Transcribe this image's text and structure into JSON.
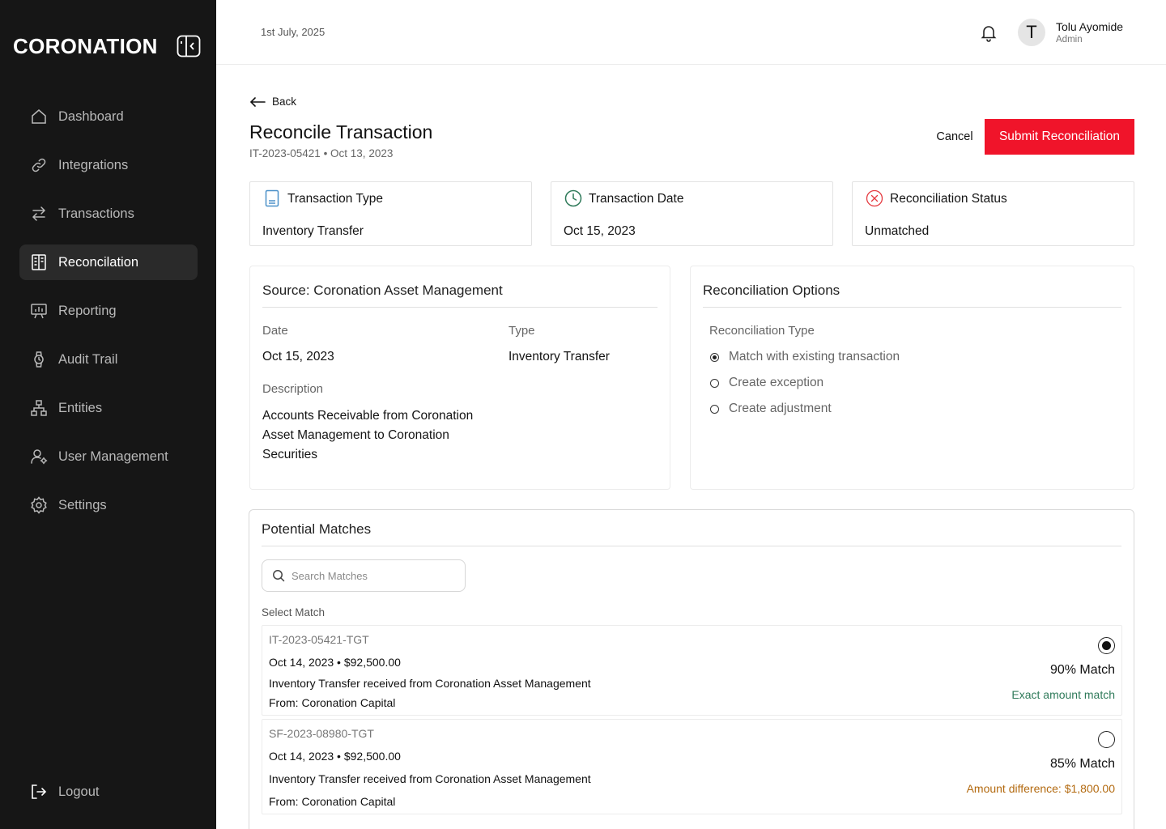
{
  "brand": {
    "name": "CORONATION"
  },
  "sidebar": {
    "items": [
      {
        "label": "Dashboard",
        "icon": "home-icon"
      },
      {
        "label": "Integrations",
        "icon": "link-icon"
      },
      {
        "label": "Transactions",
        "icon": "swap-arrows-icon"
      },
      {
        "label": "Reconcilation",
        "icon": "ledger-book-icon",
        "active": true
      },
      {
        "label": "Reporting",
        "icon": "presentation-chart-icon"
      },
      {
        "label": "Audit Trail",
        "icon": "watch-icon"
      },
      {
        "label": "Entities",
        "icon": "hierarchy-icon"
      },
      {
        "label": "User Management",
        "icon": "user-gear-icon"
      },
      {
        "label": "Settings",
        "icon": "gear-icon"
      }
    ],
    "logout_label": "Logout"
  },
  "header": {
    "date": "1st July, 2025",
    "user": {
      "initial": "T",
      "name": "Tolu Ayomide",
      "role": "Admin"
    }
  },
  "page": {
    "back_label": "Back",
    "title": "Reconcile Transaction",
    "subtitle": "IT-2023-05421 • Oct 13, 2023",
    "cancel_label": "Cancel",
    "submit_label": "Submit Reconciliation"
  },
  "info_cards": [
    {
      "label": "Transaction Type",
      "value": "Inventory Transfer",
      "icon": "document-icon",
      "color": "#4a90c8"
    },
    {
      "label": "Transaction Date",
      "value": "Oct 15, 2023",
      "icon": "clock-icon",
      "color": "#2f7a5a"
    },
    {
      "label": "Reconciliation Status",
      "value": "Unmatched",
      "icon": "x-circle-icon",
      "color": "#e5393f"
    }
  ],
  "source": {
    "title": "Source: Coronation Asset Management",
    "date_label": "Date",
    "date_value": "Oct 15, 2023",
    "type_label": "Type",
    "type_value": "Inventory Transfer",
    "description_label": "Description",
    "description_value": "Accounts Receivable from Coronation Asset Management to Coronation Securities"
  },
  "options": {
    "title": "Reconciliation Options",
    "type_label": "Reconciliation Type",
    "choices": [
      {
        "label": "Match with existing transaction",
        "selected": true
      },
      {
        "label": "Create exception",
        "selected": false
      },
      {
        "label": "Create adjustment",
        "selected": false
      }
    ]
  },
  "matches": {
    "title": "Potential Matches",
    "search_placeholder": "Search Matches",
    "select_label": "Select Match",
    "items": [
      {
        "id": "IT-2023-05421-TGT",
        "date_amount": "Oct 14, 2023 • $92,500.00",
        "description": "Inventory Transfer received from Coronation Asset Management",
        "from": "From: Coronation Capital",
        "match_pct": "90% Match",
        "note": "Exact amount match",
        "note_color": "#2f7a5a",
        "selected": true
      },
      {
        "id": "SF-2023-08980-TGT",
        "date_amount": "Oct 14, 2023 • $92,500.00",
        "description": "Inventory Transfer received from Coronation Asset Management",
        "from": "From: Coronation Capital",
        "match_pct": "85% Match",
        "note": "Amount difference: $1,800.00",
        "note_color": "#b36a10",
        "selected": false
      }
    ]
  },
  "colors": {
    "sidebar_bg": "#161616",
    "accent": "#f0142a"
  }
}
